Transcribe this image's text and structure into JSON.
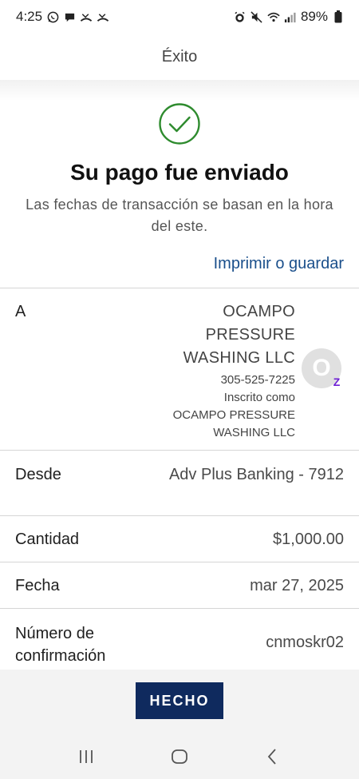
{
  "status_bar": {
    "time": "4:25",
    "battery": "89%",
    "left_icons": [
      "whatsapp-icon",
      "chat-bubble-icon",
      "missed-call-icon",
      "missed-call-icon"
    ],
    "right_icons": [
      "alarm-icon",
      "mute-icon",
      "wifi-icon",
      "signal-icon",
      "battery-icon"
    ]
  },
  "header": {
    "title": "Éxito"
  },
  "confirmation": {
    "headline": "Su pago fue enviado",
    "subtitle": "Las fechas de transacción se basan en la hora del este.",
    "print_link": "Imprimir o guardar",
    "success_color": "#2e8b2e"
  },
  "details": {
    "to": {
      "label": "A",
      "name_lines": [
        "OCAMPO",
        "PRESSURE",
        "WASHING LLC"
      ],
      "phone": "305-525-7225",
      "enrolled_label": "Inscrito como",
      "enrolled_lines": [
        "OCAMPO PRESSURE",
        "WASHING LLC"
      ],
      "avatar_initial": "O",
      "badge": "Z"
    },
    "from": {
      "label": "Desde",
      "value": "Adv Plus Banking - 7912"
    },
    "amount": {
      "label": "Cantidad",
      "value": "$1,000.00"
    },
    "date": {
      "label": "Fecha",
      "value": "mar 27, 2025"
    },
    "confirmation_number": {
      "label_line1": "Número de",
      "label_line2": "confirmación",
      "value": "cnmoskr02"
    }
  },
  "actions": {
    "done_label": "HECHO",
    "done_color": "#0f2a5e",
    "link_color": "#1a4f8b"
  },
  "nav": {
    "buttons": [
      "recent-apps",
      "home",
      "back"
    ]
  }
}
